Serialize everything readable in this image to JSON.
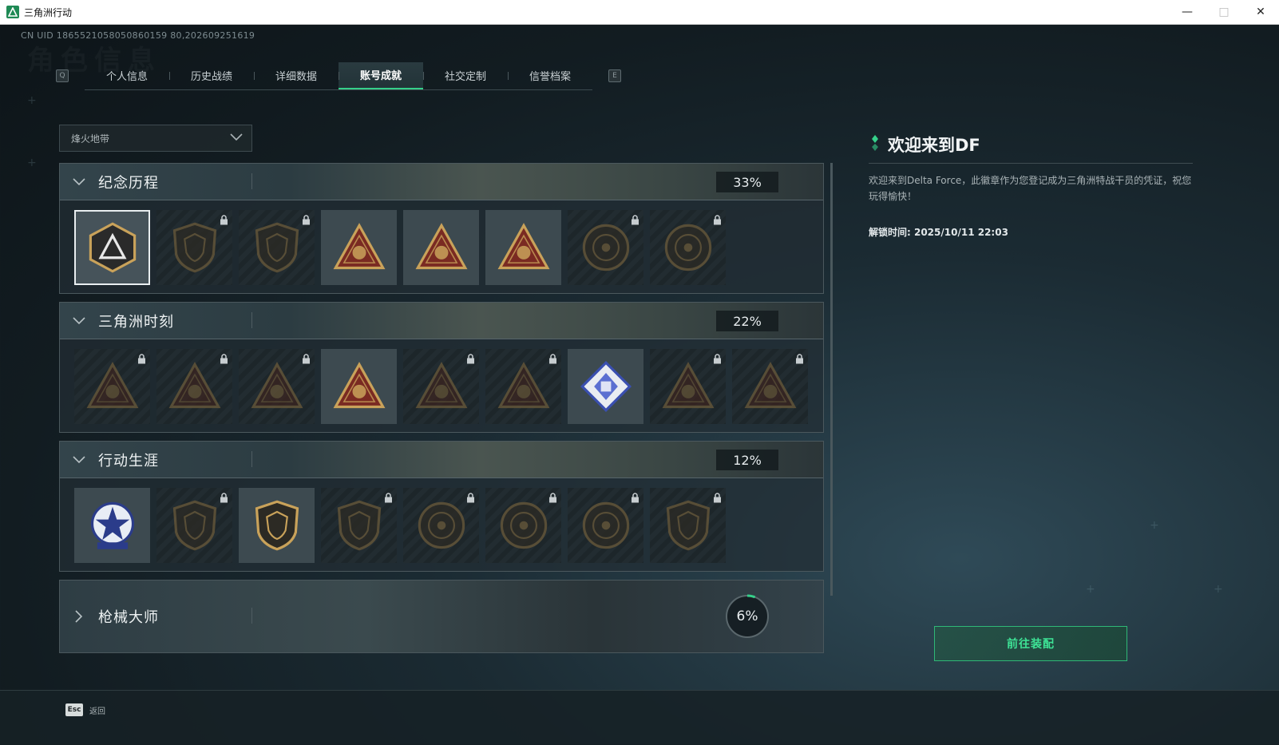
{
  "window": {
    "title": "三角洲行动",
    "minimize_icon": "minimize-icon",
    "maximize_icon": "maximize-icon",
    "close_icon": "close-icon"
  },
  "uid_text": "CN UID 1865521058050860159 80,202609251619",
  "ghost_title": "角色信息",
  "tabs": {
    "left_key": "Q",
    "right_key": "E",
    "items": [
      {
        "label": "个人信息"
      },
      {
        "label": "历史战绩"
      },
      {
        "label": "详细数据"
      },
      {
        "label": "账号成就",
        "active": true
      },
      {
        "label": "社交定制"
      },
      {
        "label": "信誉档案"
      }
    ]
  },
  "mode_select": {
    "value": "烽火地带"
  },
  "sections": [
    {
      "title": "纪念历程",
      "percent": "33%",
      "badges": [
        {
          "locked": false,
          "selected": true,
          "art": "delta-logo"
        },
        {
          "locked": true,
          "art": "helicopter"
        },
        {
          "locked": true,
          "art": "shield-emblem"
        },
        {
          "locked": false,
          "art": "eagle-triangle"
        },
        {
          "locked": false,
          "art": "number-1-triangle"
        },
        {
          "locked": false,
          "art": "number-2-triangle"
        },
        {
          "locked": true,
          "art": "round-seal"
        },
        {
          "locked": true,
          "art": "gear-seal"
        }
      ]
    },
    {
      "title": "三角洲时刻",
      "percent": "22%",
      "badges": [
        {
          "locked": true,
          "art": "soldier-triangle"
        },
        {
          "locked": true,
          "art": "runner-triangle"
        },
        {
          "locked": true,
          "art": "tech-triangle"
        },
        {
          "locked": false,
          "art": "squad-triangle"
        },
        {
          "locked": true,
          "art": "beast-triangle"
        },
        {
          "locked": true,
          "art": "dragon-triangle"
        },
        {
          "locked": false,
          "art": "cube-diamond"
        },
        {
          "locked": true,
          "art": "fox-triangle"
        },
        {
          "locked": true,
          "art": "skull-triangle"
        }
      ]
    },
    {
      "title": "行动生涯",
      "percent": "12%",
      "badges": [
        {
          "locked": false,
          "art": "star-wreath"
        },
        {
          "locked": true,
          "art": "chevron-shield"
        },
        {
          "locked": false,
          "art": "split-shield"
        },
        {
          "locked": true,
          "art": "hex-shield"
        },
        {
          "locked": true,
          "art": "disc-emblem"
        },
        {
          "locked": true,
          "art": "crosshair-emblem"
        },
        {
          "locked": true,
          "art": "eye-emblem"
        },
        {
          "locked": true,
          "art": "wolf-shield"
        }
      ]
    }
  ],
  "gun_section": {
    "title": "枪械大师",
    "percent": "6%",
    "progress": 0.06
  },
  "detail": {
    "title": "欢迎来到DF",
    "description": "欢迎来到Delta Force，此徽章作为您登记成为三角洲特战干员的凭证，祝您玩得愉快！",
    "unlock_time": "解锁时间: 2025/10/11 22:03"
  },
  "equip_button": "前往装配",
  "footer": {
    "esc_key": "Esc",
    "back_label": "返回"
  },
  "colors": {
    "accent": "#35d08a",
    "gold": "#c9a25a",
    "badge_red": "#7a2a22"
  }
}
